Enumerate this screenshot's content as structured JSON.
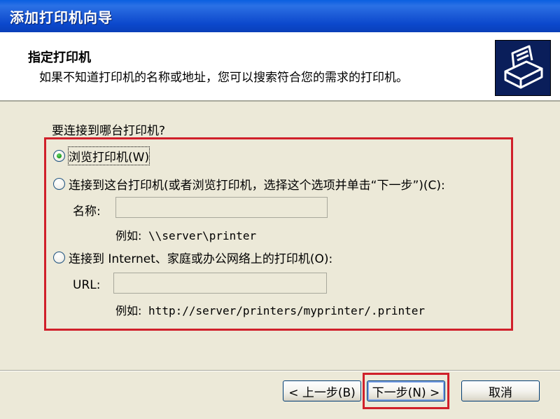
{
  "window": {
    "title": "添加打印机向导"
  },
  "header": {
    "title": "指定打印机",
    "subtitle": "如果不知道打印机的名称或地址，您可以搜索符合您的需求的打印机。",
    "icon": "printer-icon"
  },
  "question": "要连接到哪台打印机?",
  "options": {
    "browse": {
      "label": "浏览打印机(W)",
      "checked": true
    },
    "connect": {
      "label": "连接到这台打印机(或者浏览打印机，选择这个选项并单击“下一步”)(C):",
      "checked": false,
      "name_label": "名称:",
      "name_value": "",
      "example_prefix": "例如:",
      "example_value": "\\\\server\\printer"
    },
    "internet": {
      "label": "连接到 Internet、家庭或办公网络上的打印机(O):",
      "checked": false,
      "url_label": "URL:",
      "url_value": "",
      "example_prefix": "例如:",
      "example_value": "http://server/printers/myprinter/.printer"
    }
  },
  "buttons": {
    "back": "< 上一步(B)",
    "next": "下一步(N) >",
    "cancel": "取消"
  },
  "colors": {
    "titlebar": "#0B48CC",
    "highlight": "#D0202A",
    "dialog_bg": "#ECE9D8"
  }
}
